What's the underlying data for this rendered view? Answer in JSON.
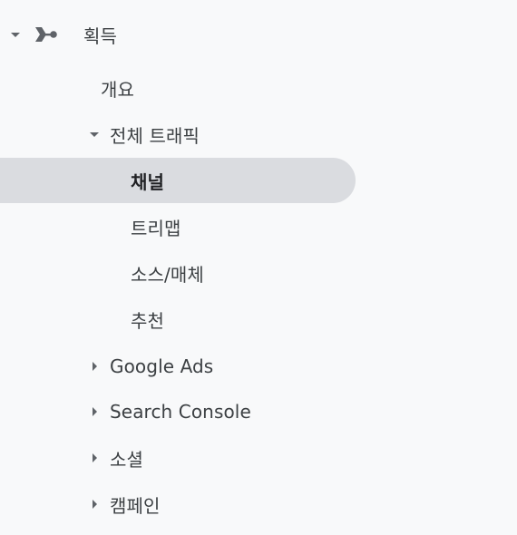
{
  "nav": {
    "section": {
      "icon": "acquisition-icon",
      "label": "획득",
      "expanded": true
    },
    "items": [
      {
        "label": "개요",
        "selected": false
      },
      {
        "label": "전체 트래픽",
        "expanded": true
      },
      {
        "label": "채널",
        "selected": true
      },
      {
        "label": "트리맵",
        "selected": false
      },
      {
        "label": "소스/매체",
        "selected": false
      },
      {
        "label": "추천",
        "selected": false
      },
      {
        "label": "Google Ads",
        "expanded": false
      },
      {
        "label": "Search Console",
        "expanded": false
      },
      {
        "label": "소셜",
        "expanded": false
      },
      {
        "label": "캠페인",
        "expanded": false
      }
    ]
  },
  "colors": {
    "background": "#f8f9fa",
    "selected_background": "#dadce0",
    "text": "#3c4043",
    "icon": "#5f6368"
  }
}
